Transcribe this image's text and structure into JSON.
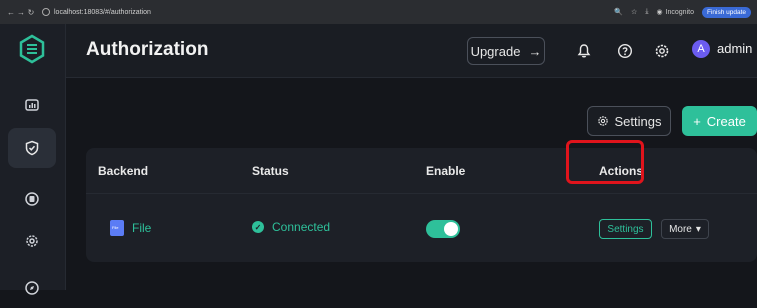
{
  "browser": {
    "url": "localhost:18083/#/authorization",
    "incognito_label": "Incognito",
    "finish_update_label": "Finish update"
  },
  "header": {
    "title": "Authorization",
    "upgrade_label": "Upgrade",
    "upgrade_icon": "arrow-right-icon",
    "user_initial": "A",
    "username": "admin"
  },
  "sidebar": {
    "items": [
      {
        "icon": "monitor-icon",
        "active": false
      },
      {
        "icon": "shield-icon",
        "active": true
      },
      {
        "icon": "plugin-icon",
        "active": false
      },
      {
        "icon": "gear-icon",
        "active": false
      },
      {
        "icon": "compass-icon",
        "active": false
      }
    ]
  },
  "toolbar": {
    "settings_label": "Settings",
    "create_label": "Create",
    "create_icon": "plus-icon"
  },
  "table": {
    "columns": [
      "Backend",
      "Status",
      "Enable",
      "Actions"
    ],
    "rows": [
      {
        "backend": "File",
        "backend_icon_text": "File",
        "status": "Connected",
        "enabled": true,
        "actions": {
          "settings": "Settings",
          "more": "More"
        }
      }
    ]
  },
  "colors": {
    "accent": "#2ec09a",
    "highlight": "#e0141c",
    "avatar": "#6b5cf0"
  }
}
